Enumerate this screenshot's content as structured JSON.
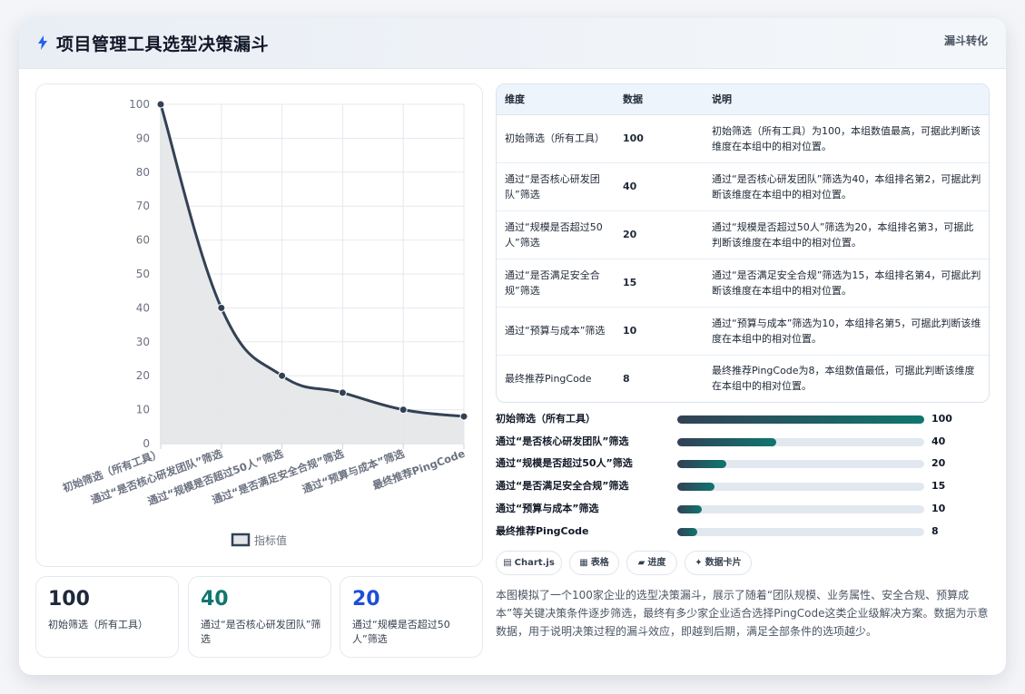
{
  "header": {
    "title": "项目管理工具选型决策漏斗",
    "tag": "漏斗转化"
  },
  "colors": {
    "line": "#334155",
    "area": "#e3e5e8",
    "kpi_dark": "#1e293b",
    "kpi_teal": "#0f766e",
    "kpi_blue": "#1d4ed8",
    "bolt": "#2563eb"
  },
  "chart_data": {
    "type": "line",
    "categories": [
      "初始筛选（所有工具）",
      "通过“是否核心研发团队”筛选",
      "通过“规模是否超过50人”筛选",
      "通过“是否满足安全合规”筛选",
      "通过“预算与成本”筛选",
      "最终推荐PingCode"
    ],
    "series": [
      {
        "name": "指标值",
        "values": [
          100,
          40,
          20,
          15,
          10,
          8
        ]
      }
    ],
    "ylim": [
      0,
      100
    ],
    "yticks": [
      0,
      10,
      20,
      30,
      40,
      50,
      60,
      70,
      80,
      90,
      100
    ],
    "grid": true,
    "legend": "bottom",
    "fill": true,
    "smooth": true
  },
  "kpis": [
    {
      "value": "100",
      "label": "初始筛选（所有工具）"
    },
    {
      "value": "40",
      "label": "通过“是否核心研发团队”筛选"
    },
    {
      "value": "20",
      "label": "通过“规模是否超过50人”筛选"
    }
  ],
  "table": {
    "headers": [
      "维度",
      "数据",
      "说明"
    ],
    "rows": [
      {
        "name": "初始筛选（所有工具）",
        "value": "100",
        "desc": "初始筛选（所有工具）为100，本组数值最高，可据此判断该维度在本组中的相对位置。"
      },
      {
        "name": "通过“是否核心研发团队”筛选",
        "value": "40",
        "desc": "通过“是否核心研发团队”筛选为40，本组排名第2，可据此判断该维度在本组中的相对位置。"
      },
      {
        "name": "通过“规模是否超过50人”筛选",
        "value": "20",
        "desc": "通过“规模是否超过50人”筛选为20，本组排名第3，可据此判断该维度在本组中的相对位置。"
      },
      {
        "name": "通过“是否满足安全合规”筛选",
        "value": "15",
        "desc": "通过“是否满足安全合规”筛选为15，本组排名第4，可据此判断该维度在本组中的相对位置。"
      },
      {
        "name": "通过“预算与成本”筛选",
        "value": "10",
        "desc": "通过“预算与成本”筛选为10，本组排名第5，可据此判断该维度在本组中的相对位置。"
      },
      {
        "name": "最终推荐PingCode",
        "value": "8",
        "desc": "最终推荐PingCode为8，本组数值最低，可据此判断该维度在本组中的相对位置。"
      }
    ]
  },
  "progress": {
    "max": 100,
    "rows": [
      {
        "label": "初始筛选（所有工具）",
        "value": 100
      },
      {
        "label": "通过“是否核心研发团队”筛选",
        "value": 40
      },
      {
        "label": "通过“规模是否超过50人”筛选",
        "value": 20
      },
      {
        "label": "通过“是否满足安全合规”筛选",
        "value": 15
      },
      {
        "label": "通过“预算与成本”筛选",
        "value": 10
      },
      {
        "label": "最终推荐PingCode",
        "value": 8
      }
    ]
  },
  "chips": [
    {
      "icon": "▤",
      "label": "Chart.js"
    },
    {
      "icon": "▦",
      "label": "表格"
    },
    {
      "icon": "▰",
      "label": "进度"
    },
    {
      "icon": "✦",
      "label": "数据卡片"
    }
  ],
  "description": "本图模拟了一个100家企业的选型决策漏斗，展示了随着“团队规模、业务属性、安全合规、预算成本”等关键决策条件逐步筛选，最终有多少家企业适合选择PingCode这类企业级解决方案。数据为示意数据，用于说明决策过程的漏斗效应，即越到后期，满足全部条件的选项越少。"
}
